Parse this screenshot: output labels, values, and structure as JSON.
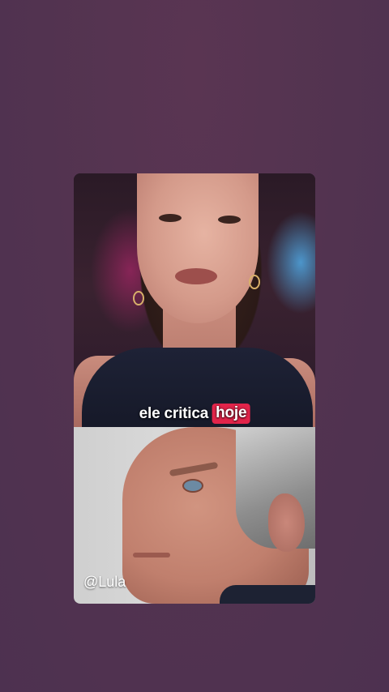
{
  "video": {
    "caption_plain": "ele critica",
    "caption_highlight": "hoje",
    "watermark": "@Lula"
  },
  "colors": {
    "background": "#523350",
    "caption_highlight": "#e2244a",
    "caption_text": "#ffffff"
  }
}
